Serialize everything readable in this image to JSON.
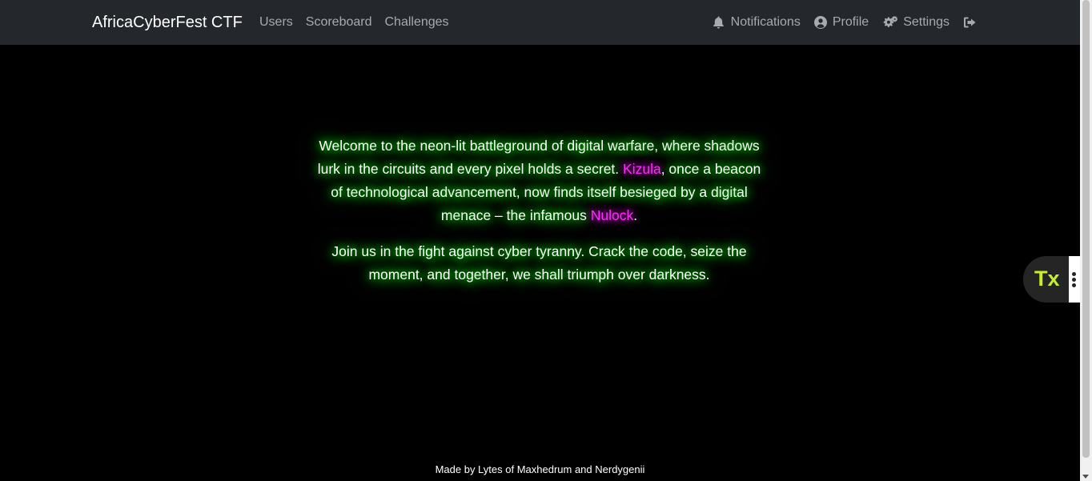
{
  "navbar": {
    "brand": "AfricaCyberFest CTF",
    "left_links": [
      {
        "label": "Users"
      },
      {
        "label": "Scoreboard"
      },
      {
        "label": "Challenges"
      }
    ],
    "right_links": [
      {
        "label": "Notifications",
        "icon": "bell-icon"
      },
      {
        "label": "Profile",
        "icon": "user-circle-icon"
      },
      {
        "label": "Settings",
        "icon": "gears-icon"
      },
      {
        "label": "",
        "icon": "logout-icon"
      }
    ]
  },
  "story": {
    "p1_part1": "Welcome to the neon-lit battleground of digital warfare, where shadows lurk in the circuits and every pixel holds a secret. ",
    "p1_highlight1": "Kizula",
    "p1_part2": ", once a beacon of technological advancement, now finds itself besieged by a digital menace – the infamous ",
    "p1_highlight2": "Nulock",
    "p1_part3": ".",
    "p2": "Join us in the fight against cyber tyranny. Crack the code, seize the moment, and together, we shall triumph over darkness."
  },
  "footer": {
    "text": "Made by Lytes of Maxhedrum and Nerdygenii"
  },
  "widget": {
    "label": "Tx"
  },
  "colors": {
    "navbar_bg": "#24272b",
    "page_bg": "#000000",
    "glow": "#00ff00",
    "highlight": "#ff2dff",
    "widget_accent": "#c7f02b"
  }
}
